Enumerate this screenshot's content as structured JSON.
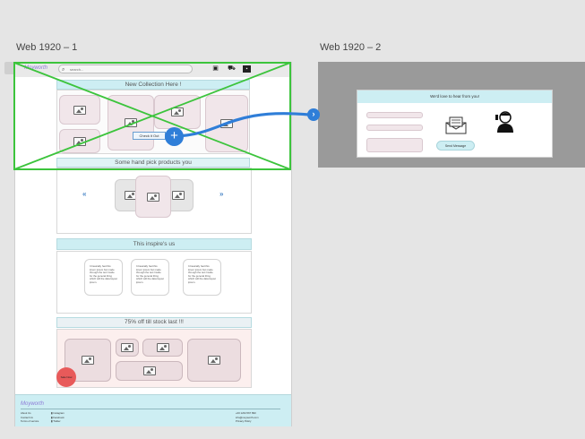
{
  "artboards": [
    {
      "title": "Web 1920 – 1"
    },
    {
      "title": "Web 1920 – 2"
    }
  ],
  "board1": {
    "nav": {
      "logo": "Moyworth",
      "search_placeholder": "search...",
      "icons": [
        "gallery-icon",
        "cart-icon",
        "account-icon"
      ]
    },
    "hero": {
      "banner": "New Collection Here !",
      "button_label": "Check it Out"
    },
    "picks": {
      "banner": "Some hand pick products you"
    },
    "inspire": {
      "banner": "This inspire's us",
      "cards": [
        "It basically had this lorem ipsum but made through the text Inside for the general thing which will the data layout ipsum.",
        "It basically had this lorem ipsum but made through the text Inside for the general thing which will the data layout ipsum.",
        "It basically had this lorem ipsum but made through the text Inside for the general thing which will the data layout ipsum."
      ]
    },
    "sale": {
      "banner": "75% off till stock last !!!",
      "badge": "Sale Now"
    },
    "footer": {
      "brand": "Moyworth",
      "links": [
        "About Us",
        "Contact Us",
        "Terms of service"
      ],
      "social": [
        "Instagram",
        "Facebook",
        "Twitter"
      ],
      "contact": [
        "+00 1234 567 890",
        "info@moyworth.com",
        "Privacy Policy"
      ]
    }
  },
  "board2": {
    "header": "We'd love to hear from you!",
    "send_label": "Send Message"
  },
  "colors": {
    "accent": "#2f7ed8",
    "selection": "#3cc43c",
    "banner": "#cdeef3",
    "placeholder_pink": "#f1e6ea",
    "sale_badge": "#e85a5a"
  }
}
